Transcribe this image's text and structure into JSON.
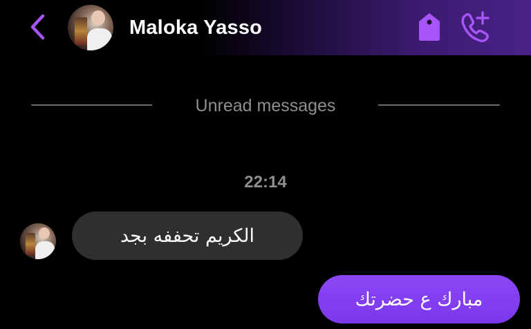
{
  "header": {
    "contact_name": "Maloka Yasso",
    "back_icon": "chevron-left-icon",
    "tag_icon": "tag-icon",
    "call_icon": "add-call-icon",
    "accent_color": "#a855f7"
  },
  "thread": {
    "divider_label": "Unread messages",
    "timestamp": "22:14",
    "messages": [
      {
        "direction": "incoming",
        "text": "الكريم تحففه بجد",
        "bubble_color": "#2f2f31"
      },
      {
        "direction": "outgoing",
        "text": "مبارك ع حضرتك",
        "bubble_color": "#7c3aed"
      }
    ]
  }
}
